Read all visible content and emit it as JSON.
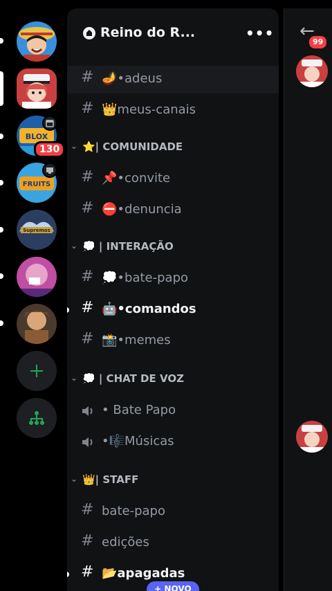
{
  "server": {
    "name": "Reino do R...",
    "menu_label": "•••"
  },
  "rail": {
    "badges": {
      "blox_fruits_count": "130"
    },
    "add_server_label": "+",
    "discover_label": "discover"
  },
  "channels": [
    {
      "type": "text",
      "name": "🪔•adeus"
    },
    {
      "type": "text",
      "name": "👑meus-canais"
    },
    {
      "type": "category",
      "name": "⭐| COMUNIDADE"
    },
    {
      "type": "text",
      "name": "📌•convite"
    },
    {
      "type": "text",
      "name": "⛔•denuncia"
    },
    {
      "type": "category",
      "name": "💭 | INTERAÇÃO"
    },
    {
      "type": "text",
      "name": "💭•bate-papo"
    },
    {
      "type": "text",
      "name": "🤖•comandos"
    },
    {
      "type": "text",
      "name": "📸•memes"
    },
    {
      "type": "category",
      "name": "💭 | CHAT DE VOZ"
    },
    {
      "type": "voice",
      "name": "• Bate Papo"
    },
    {
      "type": "voice",
      "name": "•🎼Músicas"
    },
    {
      "type": "category",
      "name": "👑| STAFF"
    },
    {
      "type": "text",
      "name": "bate-papo"
    },
    {
      "type": "text",
      "name": "edições"
    },
    {
      "type": "text",
      "name": "📂apagadas"
    }
  ],
  "new_pill": "+ NOVO",
  "right": {
    "badge": "99"
  },
  "colors": {
    "accent": "#5865f2",
    "danger": "#f23f43",
    "green": "#23a55a"
  }
}
